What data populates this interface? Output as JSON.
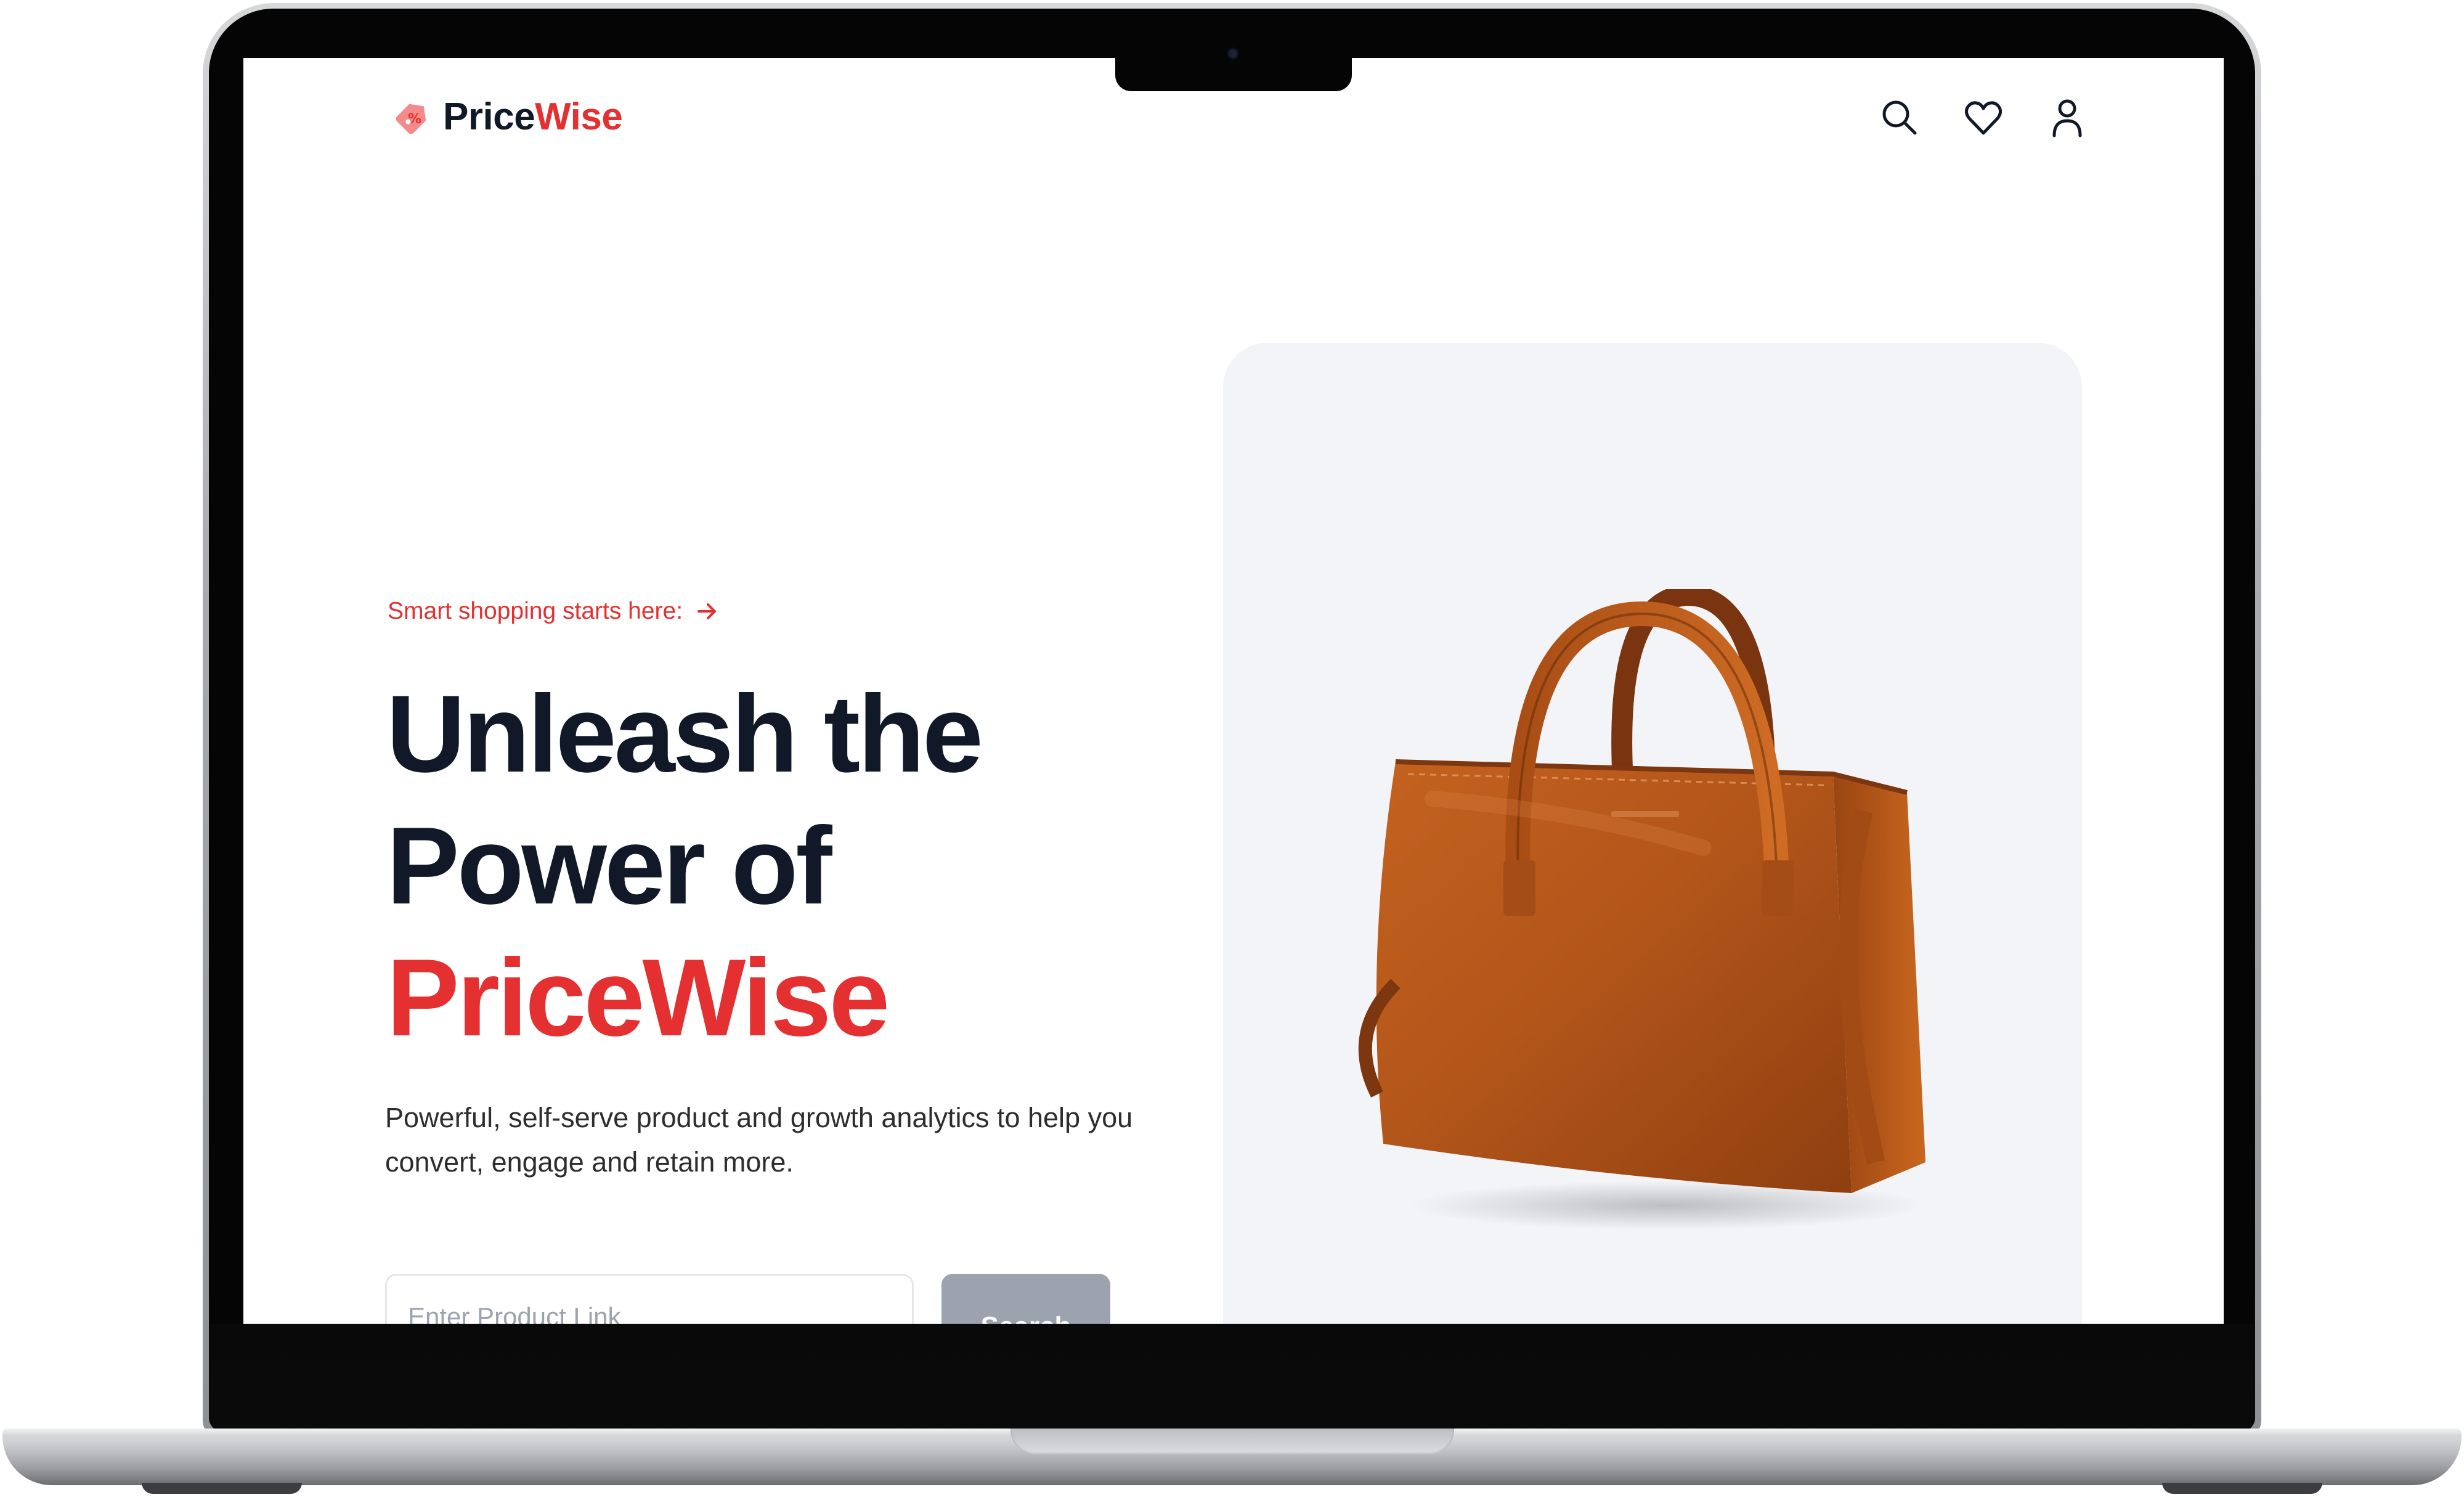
{
  "navbar": {
    "logo_prefix": "Price",
    "logo_suffix": "Wise",
    "icons": [
      "search-icon",
      "heart-icon",
      "user-icon"
    ]
  },
  "hero": {
    "tagline": "Smart shopping starts here:",
    "headline_line1": "Unleash the",
    "headline_line2": "Power of",
    "headline_accent": "PriceWise",
    "description": "Powerful, self-serve product and growth analytics to help you convert, engage and retain more.",
    "search": {
      "placeholder": "Enter Product Link",
      "button_label": "Search"
    },
    "image": "leather-tote-bag"
  },
  "colors": {
    "accent": "#e43030",
    "heading": "#111827",
    "card_background": "#f2f4f7",
    "button_disabled": "#9ca3af"
  }
}
